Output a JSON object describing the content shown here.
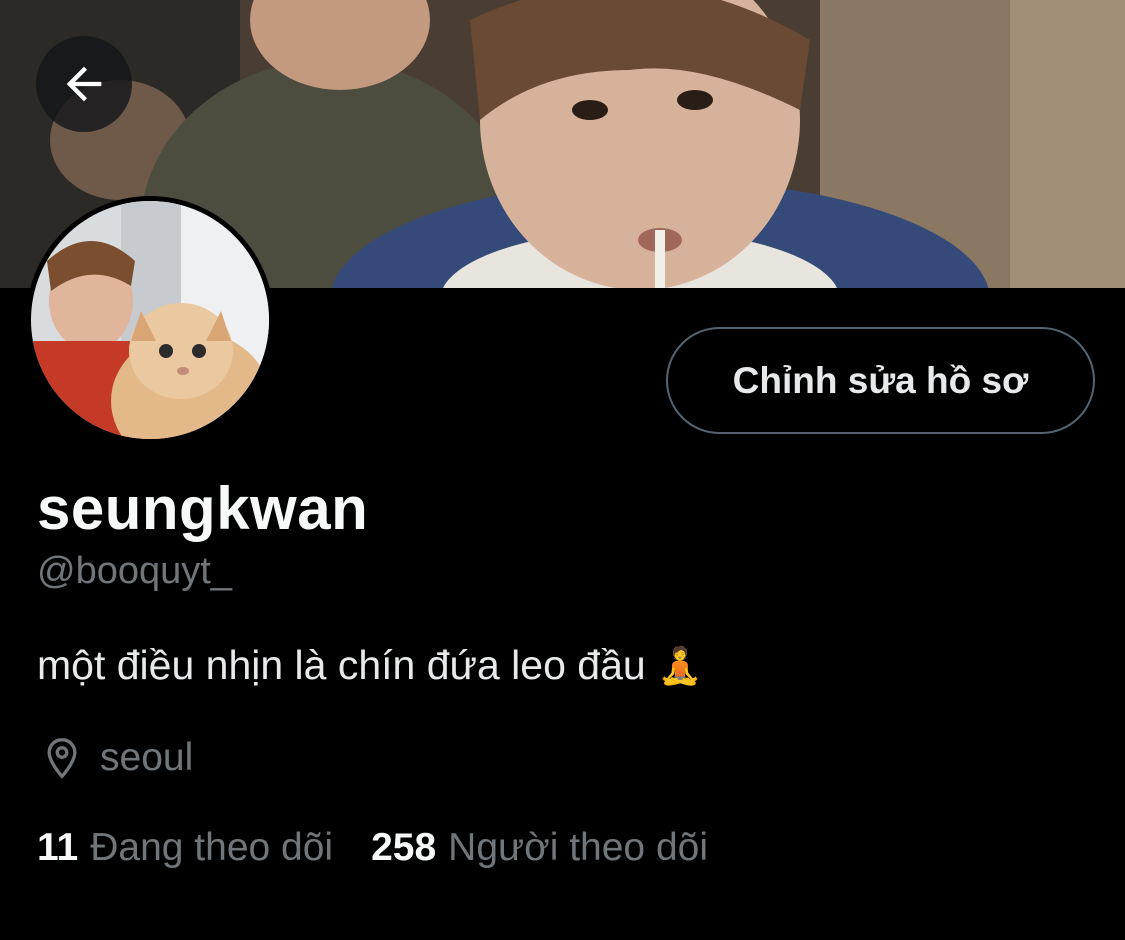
{
  "profile": {
    "display_name": "seungkwan",
    "handle": "@booquyt_",
    "bio": "một điều nhịn là chín đứa leo đầu",
    "bio_emoji": "🧘",
    "location": "seoul"
  },
  "actions": {
    "edit_profile_label": "Chỉnh sửa hồ sơ"
  },
  "stats": {
    "following_count": "11",
    "following_label": "Đang theo dõi",
    "followers_count": "258",
    "followers_label": "Người theo dõi"
  },
  "icons": {
    "back": "back-arrow-icon",
    "location": "location-pin-icon"
  },
  "colors": {
    "background": "#000000",
    "primary_text": "#e7e9ea",
    "secondary_text": "#71767b",
    "button_border": "#536471"
  }
}
